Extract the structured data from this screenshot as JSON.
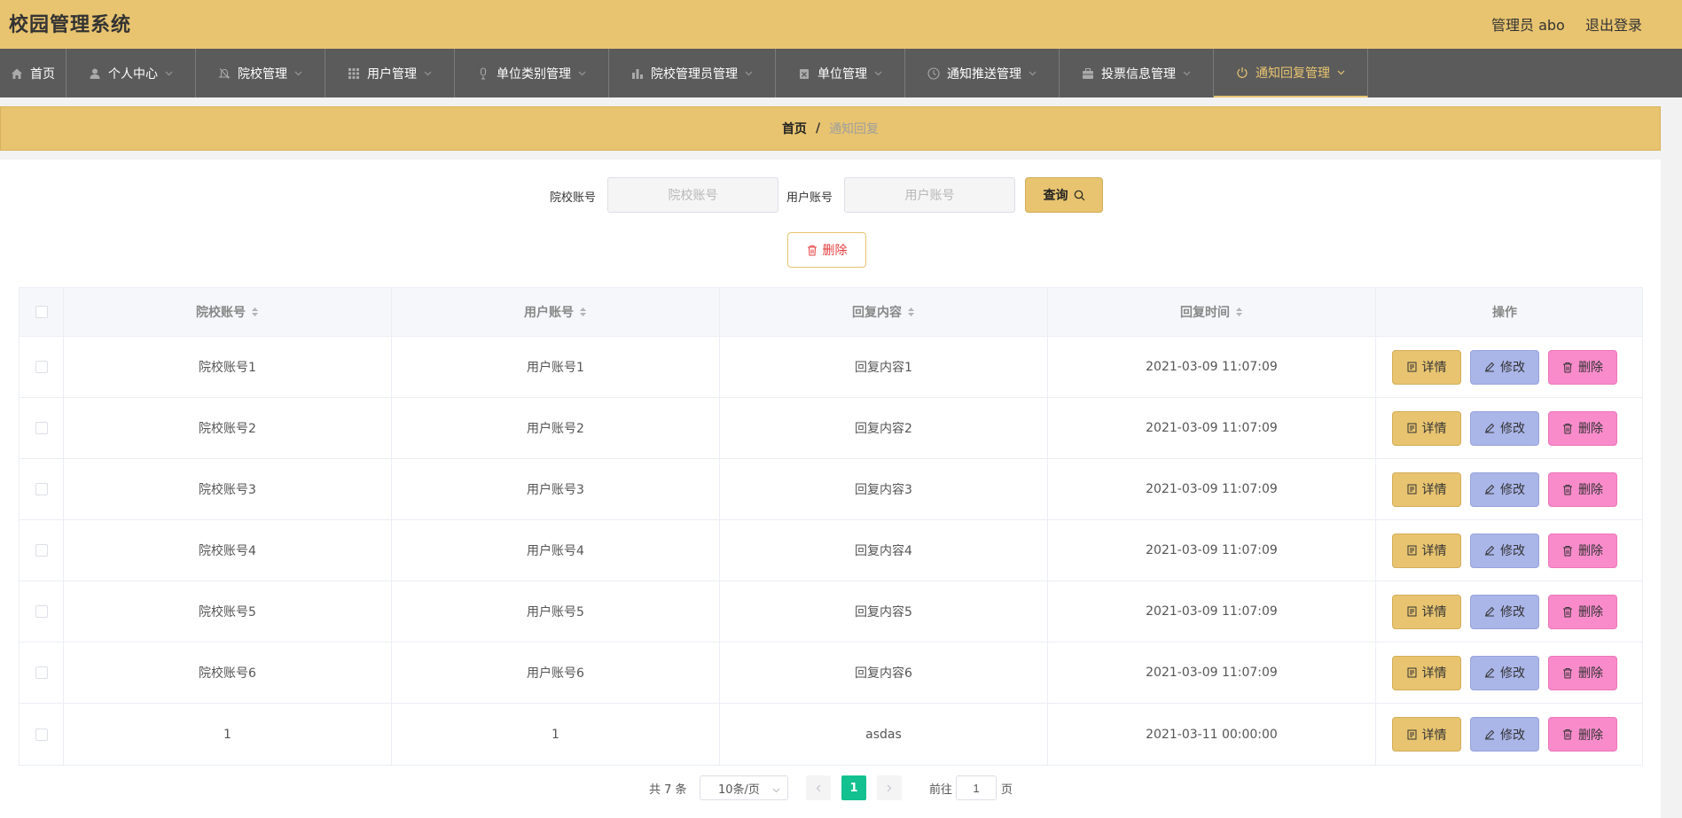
{
  "header": {
    "title": "校园管理系统",
    "user": "管理员 abo",
    "logout": "退出登录"
  },
  "nav": [
    {
      "label": "首页",
      "icon": "home-icon"
    },
    {
      "label": "个人中心",
      "icon": "user-icon"
    },
    {
      "label": "院校管理",
      "icon": "bell-off-icon"
    },
    {
      "label": "用户管理",
      "icon": "grid-icon"
    },
    {
      "label": "单位类别管理",
      "icon": "microphone-icon"
    },
    {
      "label": "院校管理员管理",
      "icon": "bar-chart-icon"
    },
    {
      "label": "单位管理",
      "icon": "delete-box-icon"
    },
    {
      "label": "通知推送管理",
      "icon": "clock-icon"
    },
    {
      "label": "投票信息管理",
      "icon": "briefcase-icon"
    },
    {
      "label": "通知回复管理",
      "icon": "power-icon"
    }
  ],
  "breadcrumb": {
    "home": "首页",
    "sep": "/",
    "current": "通知回复"
  },
  "search": {
    "school_label": "院校账号",
    "school_placeholder": "院校账号",
    "user_label": "用户账号",
    "user_placeholder": "用户账号",
    "query_label": "查询"
  },
  "bulk_delete_label": "删除",
  "table": {
    "headers": [
      "院校账号",
      "用户账号",
      "回复内容",
      "回复时间",
      "操作"
    ],
    "rows": [
      [
        "院校账号1",
        "用户账号1",
        "回复内容1",
        "2021-03-09 11:07:09"
      ],
      [
        "院校账号2",
        "用户账号2",
        "回复内容2",
        "2021-03-09 11:07:09"
      ],
      [
        "院校账号3",
        "用户账号3",
        "回复内容3",
        "2021-03-09 11:07:09"
      ],
      [
        "院校账号4",
        "用户账号4",
        "回复内容4",
        "2021-03-09 11:07:09"
      ],
      [
        "院校账号5",
        "用户账号5",
        "回复内容5",
        "2021-03-09 11:07:09"
      ],
      [
        "院校账号6",
        "用户账号6",
        "回复内容6",
        "2021-03-09 11:07:09"
      ],
      [
        "1",
        "1",
        "asdas",
        "2021-03-11 00:00:00"
      ]
    ],
    "actions": {
      "detail": "详情",
      "edit": "修改",
      "delete": "删除"
    }
  },
  "pager": {
    "total": "共 7 条",
    "page_size": "10条/页",
    "current_page": "1",
    "goto_label": "前往",
    "goto_value": "1",
    "page_suffix": "页"
  },
  "colors": {
    "accent": "#e8c470",
    "nav_bg": "#5b5b5b",
    "edit": "#aab5e8",
    "delete": "#f98bcb",
    "page_active": "#13c08f",
    "danger_text": "#e63c3c"
  }
}
